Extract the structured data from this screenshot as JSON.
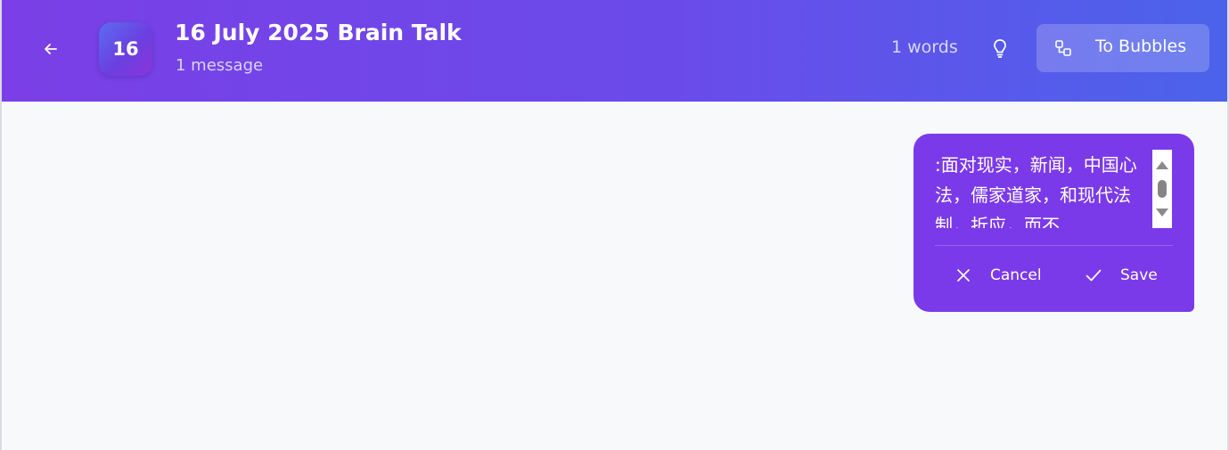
{
  "header": {
    "avatar_text": "16",
    "title": "16 July 2025 Brain Talk",
    "subtitle": "1 message",
    "word_count": "1 words",
    "to_bubbles_label": "To Bubbles"
  },
  "icons": {
    "back": "arrow-left-icon",
    "idea": "lightbulb-icon",
    "bubbles": "nodes-icon",
    "cancel": "close-icon",
    "save": "check-icon"
  },
  "message_editor": {
    "text": ":面对现实，新闻，中国心法，儒家道家，和现代法制，折应，而不",
    "cancel_label": "Cancel",
    "save_label": "Save"
  },
  "colors": {
    "header_gradient_start": "#7a3fe6",
    "header_gradient_end": "#4b63ea",
    "bubble": "#7b3ae9",
    "background": "#f8f9fb"
  }
}
